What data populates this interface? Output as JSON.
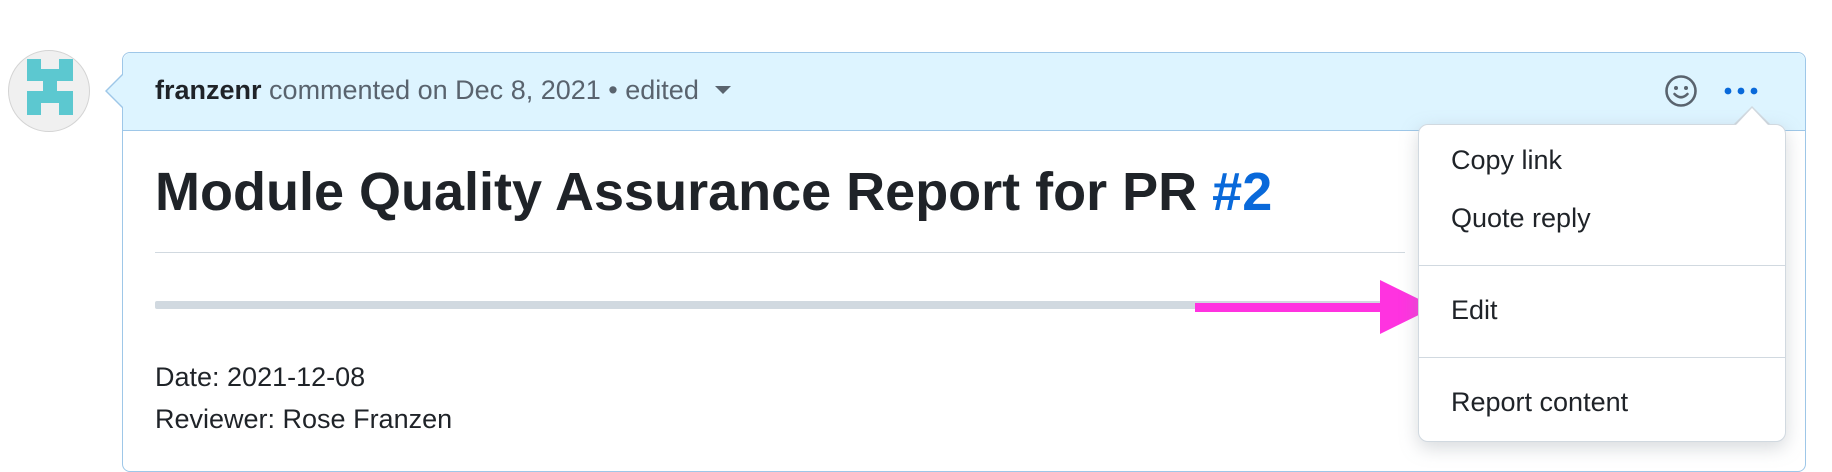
{
  "comment": {
    "author": "franzenr",
    "action": "commented on",
    "date": "Dec 8, 2021",
    "separator": "•",
    "edited": "edited"
  },
  "icons": {
    "reaction": "smiley-icon",
    "more": "kebab-horizontal-icon",
    "avatar": "identicon-avatar",
    "edited_dropdown": "triangle-down-icon"
  },
  "body": {
    "title_prefix": "Module Quality Assurance Report for PR ",
    "pr_link": "#2",
    "date_line": "Date: 2021-12-08",
    "reviewer_line": "Reviewer: Rose Franzen"
  },
  "menu": {
    "copy_link": "Copy link",
    "quote_reply": "Quote reply",
    "edit": "Edit",
    "report_content": "Report content"
  },
  "colors": {
    "header_bg": "#ddf4ff",
    "header_border": "#9ec7e8",
    "link": "#0969da",
    "annotation_arrow": "#ff33e0",
    "avatar": "#5cc8d0"
  }
}
